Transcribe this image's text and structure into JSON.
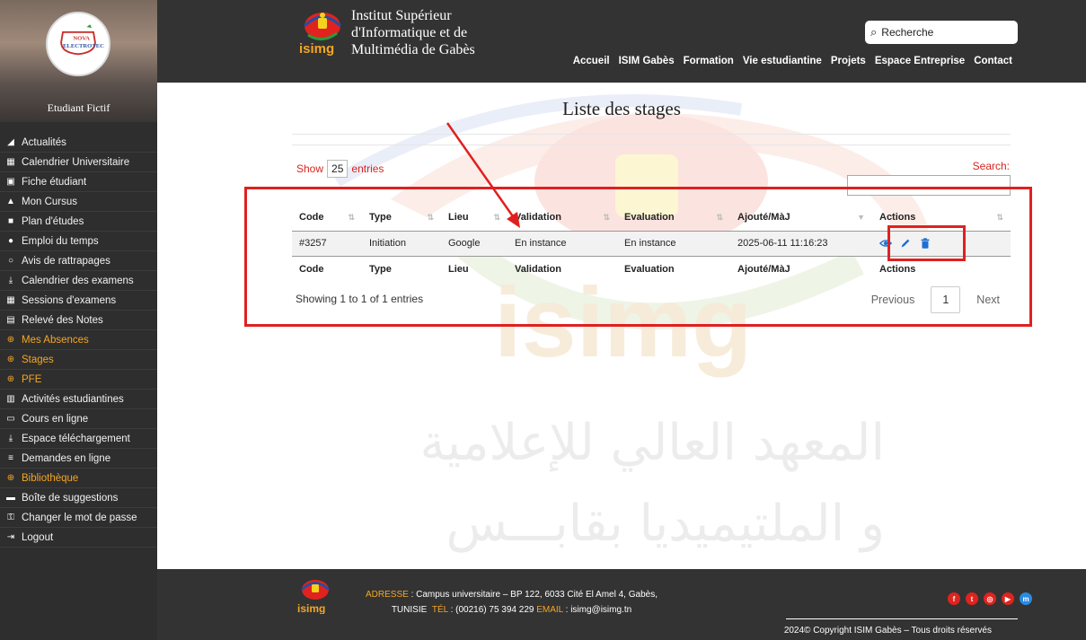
{
  "sidebar": {
    "logo_text": [
      "NOVA",
      "ELECTROTEC"
    ],
    "student_name": "Etudiant Fictif",
    "items": [
      {
        "label": "Actualités",
        "icon": "rss-icon",
        "highlight": false
      },
      {
        "label": "Calendrier Universitaire",
        "icon": "calendar-icon",
        "highlight": false
      },
      {
        "label": "Fiche étudiant",
        "icon": "id-card-icon",
        "highlight": false
      },
      {
        "label": "Mon Cursus",
        "icon": "graduation-cap-icon",
        "highlight": false
      },
      {
        "label": "Plan d'études",
        "icon": "book-icon",
        "highlight": false
      },
      {
        "label": "Emploi du temps",
        "icon": "clock-icon",
        "highlight": false
      },
      {
        "label": "Avis de rattrapages",
        "icon": "clock-outline-icon",
        "highlight": false
      },
      {
        "label": "Calendrier des examens",
        "icon": "download-icon",
        "highlight": false
      },
      {
        "label": "Sessions d'examens",
        "icon": "grid-icon",
        "highlight": false
      },
      {
        "label": "Relevé des Notes",
        "icon": "list-icon",
        "highlight": false
      },
      {
        "label": "Mes Absences",
        "icon": "plus-circle-icon",
        "highlight": true
      },
      {
        "label": "Stages",
        "icon": "plus-circle-icon",
        "highlight": true
      },
      {
        "label": "PFE",
        "icon": "plus-circle-icon",
        "highlight": true
      },
      {
        "label": "Activités estudiantines",
        "icon": "calendar-check-icon",
        "highlight": false
      },
      {
        "label": "Cours en ligne",
        "icon": "chalkboard-icon",
        "highlight": false
      },
      {
        "label": "Espace téléchargement",
        "icon": "download-icon",
        "highlight": false
      },
      {
        "label": "Demandes en ligne",
        "icon": "document-icon",
        "highlight": false
      },
      {
        "label": "Bibliothèque",
        "icon": "plus-circle-icon",
        "highlight": true
      },
      {
        "label": "Boîte de suggestions",
        "icon": "inbox-icon",
        "highlight": false
      },
      {
        "label": "Changer le mot de passe",
        "icon": "key-icon",
        "highlight": false
      },
      {
        "label": "Logout",
        "icon": "sign-out-icon",
        "highlight": false
      }
    ]
  },
  "header": {
    "institution_line1": "Institut Supérieur",
    "institution_line2": "d'Informatique et de",
    "institution_line3": "Multimédia de Gabès",
    "logo_text": "isimg",
    "search_placeholder": "Recherche",
    "nav": [
      "Accueil",
      "ISIM Gabès",
      "Formation",
      "Vie estudiantine",
      "Projets",
      "Espace Entreprise",
      "Contact"
    ]
  },
  "main": {
    "title": "Liste des stages",
    "show_label": "Show",
    "entries_value": "25",
    "entries_label": "entries",
    "search_label": "Search:",
    "columns": [
      "Code",
      "Type",
      "Lieu",
      "Validation",
      "Evaluation",
      "Ajouté/MàJ",
      "Actions"
    ],
    "rows": [
      {
        "code": "#3257",
        "type": "Initiation",
        "lieu": "Google",
        "validation": "En instance",
        "evaluation": "En instance",
        "date": "2025-06-11 11:16:23"
      }
    ],
    "info": "Showing 1 to 1 of 1 entries",
    "pagination": {
      "previous": "Previous",
      "current": "1",
      "next": "Next"
    },
    "watermark_text": "isimg",
    "watermark_arabic_1": "المعهد العالي للإعلامية",
    "watermark_arabic_2": "و الملتيميديا بقابـــس"
  },
  "footer": {
    "logo_text": "isimg",
    "address_label": "ADRESSE",
    "address": ": Campus universitaire – BP 122, 6033 Cité El Amel 4, Gabès,",
    "country": "TUNISIE",
    "tel_label": "TÉL",
    "tel": ": (00216) 75 394 229",
    "email_label": "EMAIL",
    "email": ": isimg@isimg.tn",
    "copyright": "2024© Copyright ISIM Gabès – Tous droits réservés",
    "social": [
      "facebook-icon",
      "twitter-icon",
      "instagram-icon",
      "youtube-icon",
      "messenger-icon"
    ]
  },
  "colors": {
    "accent_red": "#e02020",
    "highlight_orange": "#f6a623",
    "sidebar_bg": "#2e2e2e",
    "header_bg": "#333333",
    "action_blue": "#1f6fd1"
  }
}
